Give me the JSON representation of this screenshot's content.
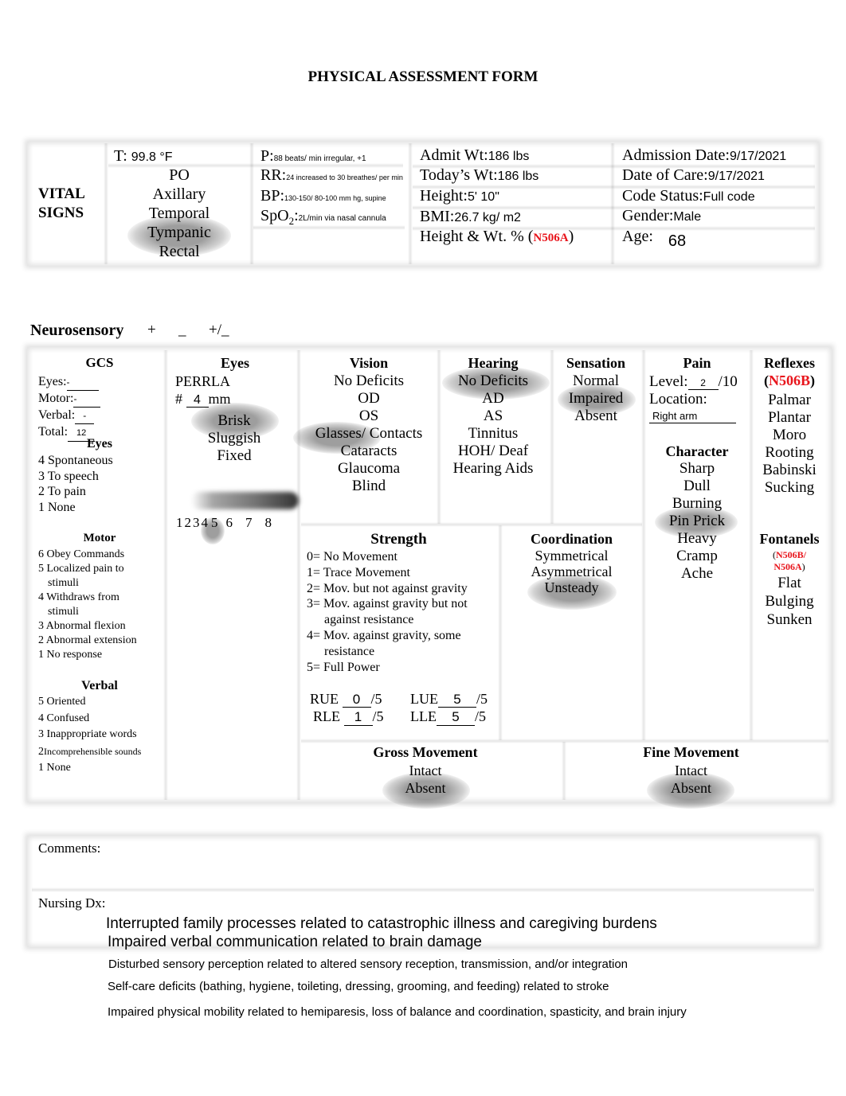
{
  "title": "PHYSICAL ASSESSMENT FORM",
  "vital_signs": {
    "label_line1": "VITAL",
    "label_line2": "SIGNS",
    "temp_label": "T:",
    "temp_value": "99.8 °F",
    "temp_routes": [
      "PO",
      "Axillary",
      "Temporal",
      "Tympanic",
      "Rectal"
    ],
    "temp_route_selected": "Tympanic",
    "pulse_label": "P:",
    "pulse_value": "88 beats/ min irregular, +1",
    "rr_label": "RR:",
    "rr_value": "24 increased to 30 breathes/ per min",
    "bp_label": "BP:",
    "bp_value": "130-150/ 80-100 mm hg, supine",
    "spo2_label": "SpO",
    "spo2_sub": "2",
    "spo2_colon": ":",
    "spo2_value": "2L/min via nasal cannula",
    "admit_wt_label": "Admit Wt:",
    "admit_wt_value": "186 lbs",
    "todays_wt_label": "Today’s Wt:",
    "todays_wt_value": "186 lbs",
    "height_label": "Height:",
    "height_value": "5' 10\"",
    "bmi_label": "BMI:",
    "bmi_value": "26.7 kg/ m2",
    "hw_pct_label": "Height & Wt. % (",
    "hw_pct_code": "N506A",
    "hw_pct_close": ")",
    "admission_date_label": "Admission Date:",
    "admission_date_value": "9/17/2021",
    "date_of_care_label": "Date of Care:",
    "date_of_care_value": "9/17/2021",
    "code_status_label": "Code Status:",
    "code_status_value": "Full code",
    "gender_label": "Gender:",
    "gender_value": "Male",
    "age_label": "Age:",
    "age_value": "68"
  },
  "neurosensory": {
    "title": "Neurosensory",
    "symbols": [
      "+",
      "_",
      "+/_"
    ],
    "gcs": {
      "title": "GCS",
      "eyes_label": "Eyes:",
      "eyes_value": "-",
      "motor_label": "Motor:",
      "motor_value": "-",
      "verbal_label": "Verbal:",
      "verbal_value": "-",
      "total_label": "Total:",
      "total_value": "12",
      "eyes_title": "Eyes",
      "eyes_items": [
        "4  Spontaneous",
        "3 To speech",
        "2 To pain",
        "1 None"
      ],
      "motor_title": "Motor",
      "motor_items": [
        "6 Obey Commands",
        "5 Localized pain to",
        "stimuli",
        "4 Withdraws from",
        "stimuli",
        "3 Abnormal flexion",
        "2 Abnormal extension",
        "1 No response"
      ],
      "verbal_title": "Verbal",
      "verbal_items": [
        "5 Oriented",
        "4 Confused",
        "3 Inappropriate words",
        "2",
        "Incomprehensible sounds",
        "1 None"
      ]
    },
    "eyes": {
      "title": "Eyes",
      "perrla": "PERRLA",
      "size_prefix": "#",
      "size_value": "4",
      "size_unit": "mm",
      "reactivity": [
        "Brisk",
        "Sluggish",
        "Fixed"
      ],
      "reactivity_selected": "Brisk",
      "pupil_scale": [
        "1",
        "2",
        "3",
        "4",
        "5",
        "6",
        "7",
        "8"
      ],
      "pupil_selected": "4"
    },
    "vision": {
      "title": "Vision",
      "items": [
        "No Deficits",
        "OD",
        "OS",
        "Glasses/ Contacts",
        "Cataracts",
        "Glaucoma",
        "Blind"
      ],
      "selected": "Glasses/ Contacts"
    },
    "hearing": {
      "title": "Hearing",
      "items": [
        "No Deficits",
        "AD",
        "AS",
        "Tinnitus",
        "HOH/ Deaf",
        "Hearing Aids"
      ],
      "selected": "No Deficits"
    },
    "sensation": {
      "title": "Sensation",
      "items": [
        "Normal",
        "Impaired",
        "Absent"
      ],
      "selected": "Impaired"
    },
    "pain": {
      "title": "Pain",
      "level_label": "Level:",
      "level_value": "2",
      "level_suffix": "/10",
      "location_label": "Location:",
      "location_value": "Right arm",
      "character_title": "Character",
      "character_items": [
        "Sharp",
        "Dull",
        "Burning",
        "Pin Prick",
        "Heavy",
        "Cramp",
        "Ache"
      ],
      "character_selected": "Pin Prick"
    },
    "reflexes": {
      "title": "Reflexes",
      "code_open": "(",
      "code": "N506B",
      "code_close": ")",
      "items": [
        "Palmar",
        "Plantar",
        "Moro",
        "Rooting",
        "Babinski",
        "Sucking"
      ]
    },
    "strength": {
      "title": "Strength",
      "scale": [
        "0= No Movement",
        "1= Trace Movement",
        "2= Mov. but not against gravity",
        "3= Mov. against gravity but not",
        "against resistance",
        "4= Mov. against gravity, some",
        "resistance",
        "5= Full Power"
      ],
      "rue_label": "RUE",
      "rue_value": "0",
      "lue_label": "LUE",
      "lue_value": "5",
      "rle_label": "RLE",
      "rle_value": "1",
      "lle_label": "LLE",
      "lle_value": "5",
      "out_of": "/5"
    },
    "coordination": {
      "title": "Coordination",
      "items": [
        "Symmetrical",
        "Asymmetrical",
        "Unsteady"
      ],
      "selected": "Unsteady"
    },
    "fontanels": {
      "title": "Fontanels",
      "code_open": "(",
      "code_line1": "N506B/",
      "code_line2": "N506A",
      "code_close": ")",
      "items": [
        "Flat",
        "Bulging",
        "Sunken"
      ]
    },
    "gross_movement": {
      "title": "Gross Movement",
      "items": [
        "Intact",
        "Absent"
      ],
      "selected": "Absent"
    },
    "fine_movement": {
      "title": "Fine Movement",
      "items": [
        "Intact",
        "Absent"
      ],
      "selected": "Absent"
    }
  },
  "comments": {
    "label": "Comments:",
    "value": ""
  },
  "nursing_dx": {
    "label": "Nursing Dx:",
    "items": [
      "Interrupted family processes related to catastrophic illness and caregiving burdens",
      "Impaired verbal communication related to brain damage",
      "Disturbed sensory perception related to altered sensory reception, transmission, and/or integration",
      "Self-care deficits (bathing, hygiene, toileting, dressing, grooming, and feeding) related to stroke",
      "Impaired physical mobility related to hemiparesis, loss of balance and coordination, spasticity, and brain injury"
    ]
  }
}
